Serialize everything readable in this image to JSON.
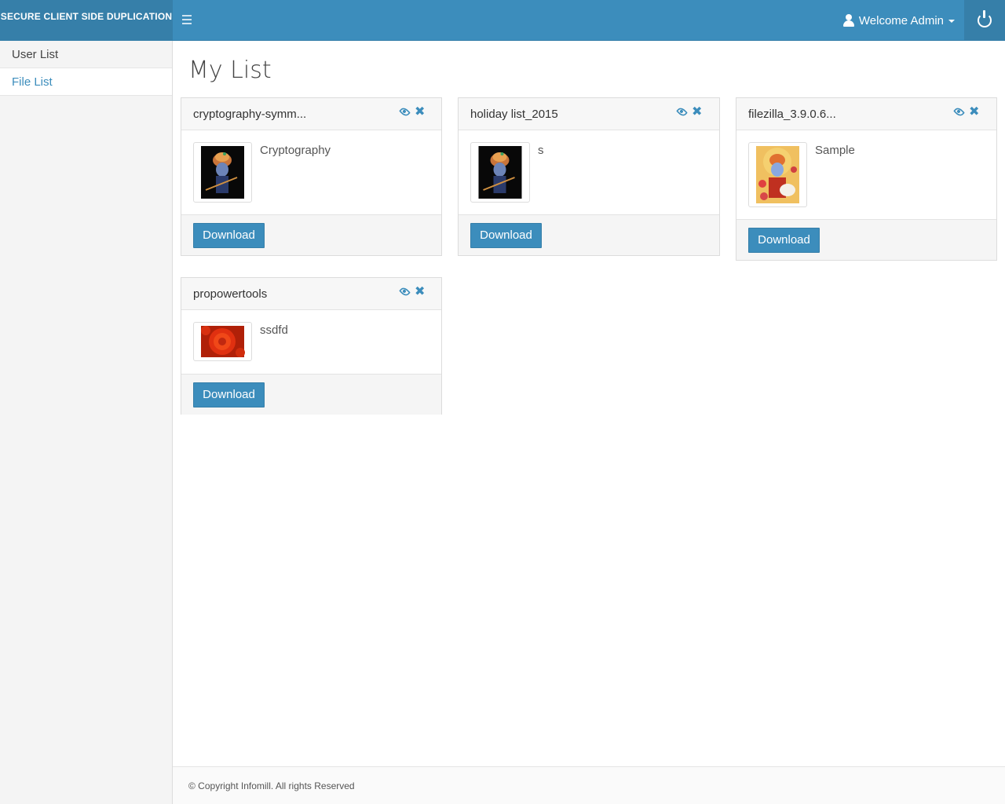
{
  "header": {
    "brand": "SECURE CLIENT SIDE DUPLICATION",
    "welcome": "Welcome Admin"
  },
  "sidebar": {
    "items": [
      {
        "label": "User List",
        "active": false
      },
      {
        "label": "File List",
        "active": true
      }
    ]
  },
  "main": {
    "title": "My List",
    "cards": [
      {
        "title": "cryptography-symm...",
        "description": "Cryptography",
        "thumbnail": "krishna-dark",
        "button": "Download"
      },
      {
        "title": "holiday list_2015",
        "description": "s",
        "thumbnail": "krishna-dark",
        "button": "Download"
      },
      {
        "title": "filezilla_3.9.0.6...",
        "description": "Sample",
        "thumbnail": "krishna-color",
        "button": "Download"
      },
      {
        "title": "propowertools",
        "description": "ssdfd",
        "thumbnail": "red-flower",
        "button": "Download"
      }
    ]
  },
  "footer": {
    "text": "© Copyright Infomill. All rights Reserved"
  },
  "colors": {
    "primary": "#3c8dbc",
    "primary_dark": "#367fa9"
  }
}
